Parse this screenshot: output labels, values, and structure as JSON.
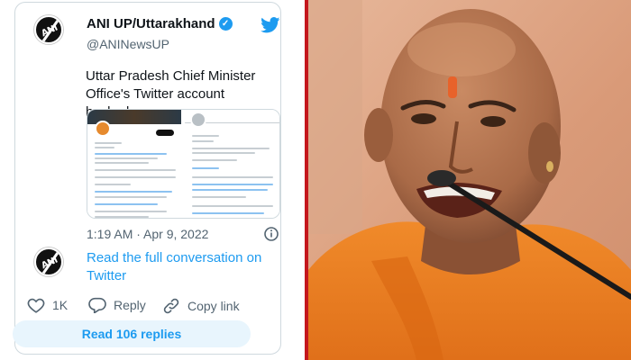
{
  "tweet": {
    "author_name": "ANI UP/Uttarakhand",
    "verified_mark": "✓",
    "handle": "@ANINewsUP",
    "text": "Uttar Pradesh Chief Minister Office's Twitter account hacked.",
    "timestamp": "1:19 AM · Apr 9, 2022",
    "read_full": "Read the full conversation on Twitter",
    "avatar_text": "ANI",
    "brand_color": "#1d9bf0"
  },
  "actions": {
    "like_count": "1K",
    "reply_label": "Reply",
    "copy_label": "Copy link"
  },
  "read_replies_label": "Read 106 replies",
  "icons": [
    "twitter-bird-icon",
    "verified-icon",
    "info-icon",
    "heart-icon",
    "reply-icon",
    "link-icon"
  ],
  "photo": {
    "subject": "photo-of-speaker-with-microphone",
    "accent_color": "#c4171d"
  }
}
